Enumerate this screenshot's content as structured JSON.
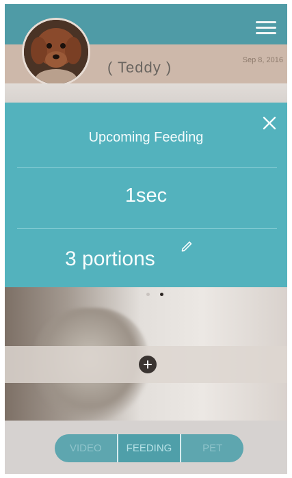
{
  "header": {
    "menu_icon": "hamburger-menu-icon"
  },
  "profile": {
    "pet_name": "( Teddy )",
    "date": "Sep 8, 2016",
    "avatar": "dog-photo"
  },
  "feeding_panel": {
    "title": "Upcoming Feeding",
    "countdown": "1sec",
    "portions": "3 portions",
    "close_icon": "close-icon",
    "edit_icon": "pencil-edit-icon"
  },
  "carousel": {
    "total_dots": 2,
    "active_dot": 2
  },
  "add_button": {
    "icon": "plus-circle-icon"
  },
  "bottom_nav": {
    "video": "VIDEO",
    "feeding": "FEEDING",
    "pet": "PET",
    "active": "FEEDING"
  },
  "colors": {
    "accent": "#53b2bd",
    "header": "#4f9ba6",
    "nav": "#5ea6af"
  }
}
